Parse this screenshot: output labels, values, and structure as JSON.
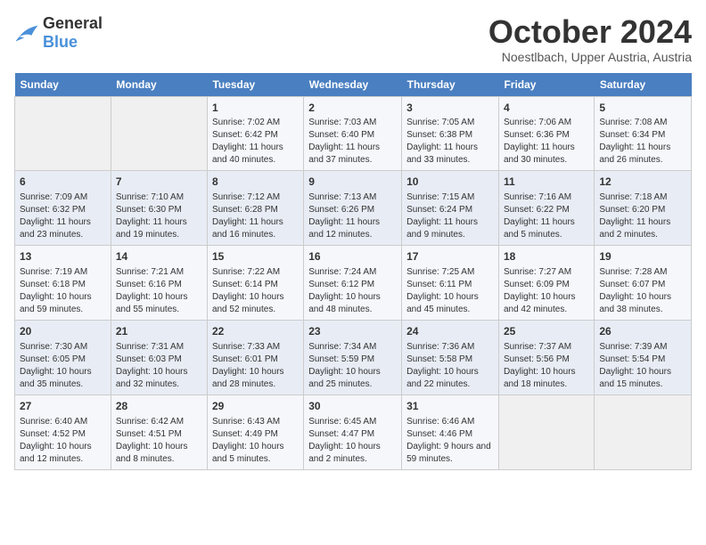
{
  "header": {
    "logo_general": "General",
    "logo_blue": "Blue",
    "month": "October 2024",
    "location": "Noestlbach, Upper Austria, Austria"
  },
  "days_of_week": [
    "Sunday",
    "Monday",
    "Tuesday",
    "Wednesday",
    "Thursday",
    "Friday",
    "Saturday"
  ],
  "weeks": [
    [
      {
        "day": "",
        "content": ""
      },
      {
        "day": "",
        "content": ""
      },
      {
        "day": "1",
        "content": "Sunrise: 7:02 AM\nSunset: 6:42 PM\nDaylight: 11 hours and 40 minutes."
      },
      {
        "day": "2",
        "content": "Sunrise: 7:03 AM\nSunset: 6:40 PM\nDaylight: 11 hours and 37 minutes."
      },
      {
        "day": "3",
        "content": "Sunrise: 7:05 AM\nSunset: 6:38 PM\nDaylight: 11 hours and 33 minutes."
      },
      {
        "day": "4",
        "content": "Sunrise: 7:06 AM\nSunset: 6:36 PM\nDaylight: 11 hours and 30 minutes."
      },
      {
        "day": "5",
        "content": "Sunrise: 7:08 AM\nSunset: 6:34 PM\nDaylight: 11 hours and 26 minutes."
      }
    ],
    [
      {
        "day": "6",
        "content": "Sunrise: 7:09 AM\nSunset: 6:32 PM\nDaylight: 11 hours and 23 minutes."
      },
      {
        "day": "7",
        "content": "Sunrise: 7:10 AM\nSunset: 6:30 PM\nDaylight: 11 hours and 19 minutes."
      },
      {
        "day": "8",
        "content": "Sunrise: 7:12 AM\nSunset: 6:28 PM\nDaylight: 11 hours and 16 minutes."
      },
      {
        "day": "9",
        "content": "Sunrise: 7:13 AM\nSunset: 6:26 PM\nDaylight: 11 hours and 12 minutes."
      },
      {
        "day": "10",
        "content": "Sunrise: 7:15 AM\nSunset: 6:24 PM\nDaylight: 11 hours and 9 minutes."
      },
      {
        "day": "11",
        "content": "Sunrise: 7:16 AM\nSunset: 6:22 PM\nDaylight: 11 hours and 5 minutes."
      },
      {
        "day": "12",
        "content": "Sunrise: 7:18 AM\nSunset: 6:20 PM\nDaylight: 11 hours and 2 minutes."
      }
    ],
    [
      {
        "day": "13",
        "content": "Sunrise: 7:19 AM\nSunset: 6:18 PM\nDaylight: 10 hours and 59 minutes."
      },
      {
        "day": "14",
        "content": "Sunrise: 7:21 AM\nSunset: 6:16 PM\nDaylight: 10 hours and 55 minutes."
      },
      {
        "day": "15",
        "content": "Sunrise: 7:22 AM\nSunset: 6:14 PM\nDaylight: 10 hours and 52 minutes."
      },
      {
        "day": "16",
        "content": "Sunrise: 7:24 AM\nSunset: 6:12 PM\nDaylight: 10 hours and 48 minutes."
      },
      {
        "day": "17",
        "content": "Sunrise: 7:25 AM\nSunset: 6:11 PM\nDaylight: 10 hours and 45 minutes."
      },
      {
        "day": "18",
        "content": "Sunrise: 7:27 AM\nSunset: 6:09 PM\nDaylight: 10 hours and 42 minutes."
      },
      {
        "day": "19",
        "content": "Sunrise: 7:28 AM\nSunset: 6:07 PM\nDaylight: 10 hours and 38 minutes."
      }
    ],
    [
      {
        "day": "20",
        "content": "Sunrise: 7:30 AM\nSunset: 6:05 PM\nDaylight: 10 hours and 35 minutes."
      },
      {
        "day": "21",
        "content": "Sunrise: 7:31 AM\nSunset: 6:03 PM\nDaylight: 10 hours and 32 minutes."
      },
      {
        "day": "22",
        "content": "Sunrise: 7:33 AM\nSunset: 6:01 PM\nDaylight: 10 hours and 28 minutes."
      },
      {
        "day": "23",
        "content": "Sunrise: 7:34 AM\nSunset: 5:59 PM\nDaylight: 10 hours and 25 minutes."
      },
      {
        "day": "24",
        "content": "Sunrise: 7:36 AM\nSunset: 5:58 PM\nDaylight: 10 hours and 22 minutes."
      },
      {
        "day": "25",
        "content": "Sunrise: 7:37 AM\nSunset: 5:56 PM\nDaylight: 10 hours and 18 minutes."
      },
      {
        "day": "26",
        "content": "Sunrise: 7:39 AM\nSunset: 5:54 PM\nDaylight: 10 hours and 15 minutes."
      }
    ],
    [
      {
        "day": "27",
        "content": "Sunrise: 6:40 AM\nSunset: 4:52 PM\nDaylight: 10 hours and 12 minutes."
      },
      {
        "day": "28",
        "content": "Sunrise: 6:42 AM\nSunset: 4:51 PM\nDaylight: 10 hours and 8 minutes."
      },
      {
        "day": "29",
        "content": "Sunrise: 6:43 AM\nSunset: 4:49 PM\nDaylight: 10 hours and 5 minutes."
      },
      {
        "day": "30",
        "content": "Sunrise: 6:45 AM\nSunset: 4:47 PM\nDaylight: 10 hours and 2 minutes."
      },
      {
        "day": "31",
        "content": "Sunrise: 6:46 AM\nSunset: 4:46 PM\nDaylight: 9 hours and 59 minutes."
      },
      {
        "day": "",
        "content": ""
      },
      {
        "day": "",
        "content": ""
      }
    ]
  ]
}
